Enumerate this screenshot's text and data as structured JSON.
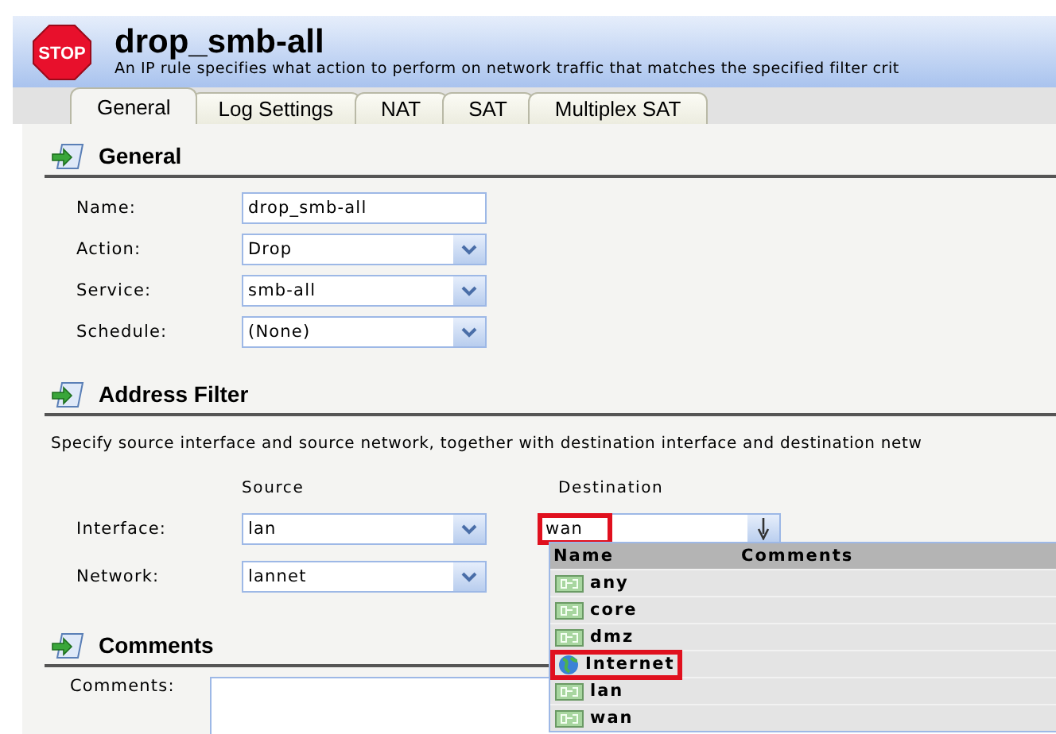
{
  "header": {
    "icon_text": "STOP",
    "title": "drop_smb-all",
    "subtitle": "An IP rule specifies what action to perform on network traffic that matches the specified filter crit"
  },
  "tabs": [
    {
      "label": "General",
      "selected": true
    },
    {
      "label": "Log Settings",
      "selected": false
    },
    {
      "label": "NAT",
      "selected": false
    },
    {
      "label": "SAT",
      "selected": false
    },
    {
      "label": "Multiplex SAT",
      "selected": false
    }
  ],
  "general": {
    "title": "General",
    "fields": [
      {
        "label": "Name:",
        "kind": "text",
        "value": "drop_smb-all"
      },
      {
        "label": "Action:",
        "kind": "select",
        "value": "Drop"
      },
      {
        "label": "Service:",
        "kind": "select",
        "value": "smb-all"
      },
      {
        "label": "Schedule:",
        "kind": "select",
        "value": "(None)"
      }
    ]
  },
  "address_filter": {
    "title": "Address Filter",
    "description": "Specify source interface and source network, together with destination interface and destination netw",
    "source_heading": "Source",
    "destination_heading": "Destination",
    "rows": [
      {
        "label": "Interface:",
        "source": "lan",
        "destination": {
          "value": "wan",
          "highlighted": true
        }
      },
      {
        "label": "Network:",
        "source": "lannet"
      }
    ]
  },
  "dropdown": {
    "columns": [
      "Name",
      "Comments"
    ],
    "items": [
      {
        "name": "any",
        "kind": "network",
        "highlighted": false
      },
      {
        "name": "core",
        "kind": "network",
        "highlighted": false
      },
      {
        "name": "dmz",
        "kind": "network",
        "highlighted": false
      },
      {
        "name": "Internet",
        "kind": "internet",
        "highlighted": true
      },
      {
        "name": "lan",
        "kind": "network",
        "highlighted": false
      },
      {
        "name": "wan",
        "kind": "network",
        "highlighted": false
      }
    ]
  },
  "comments": {
    "title": "Comments",
    "label": "Comments:"
  }
}
